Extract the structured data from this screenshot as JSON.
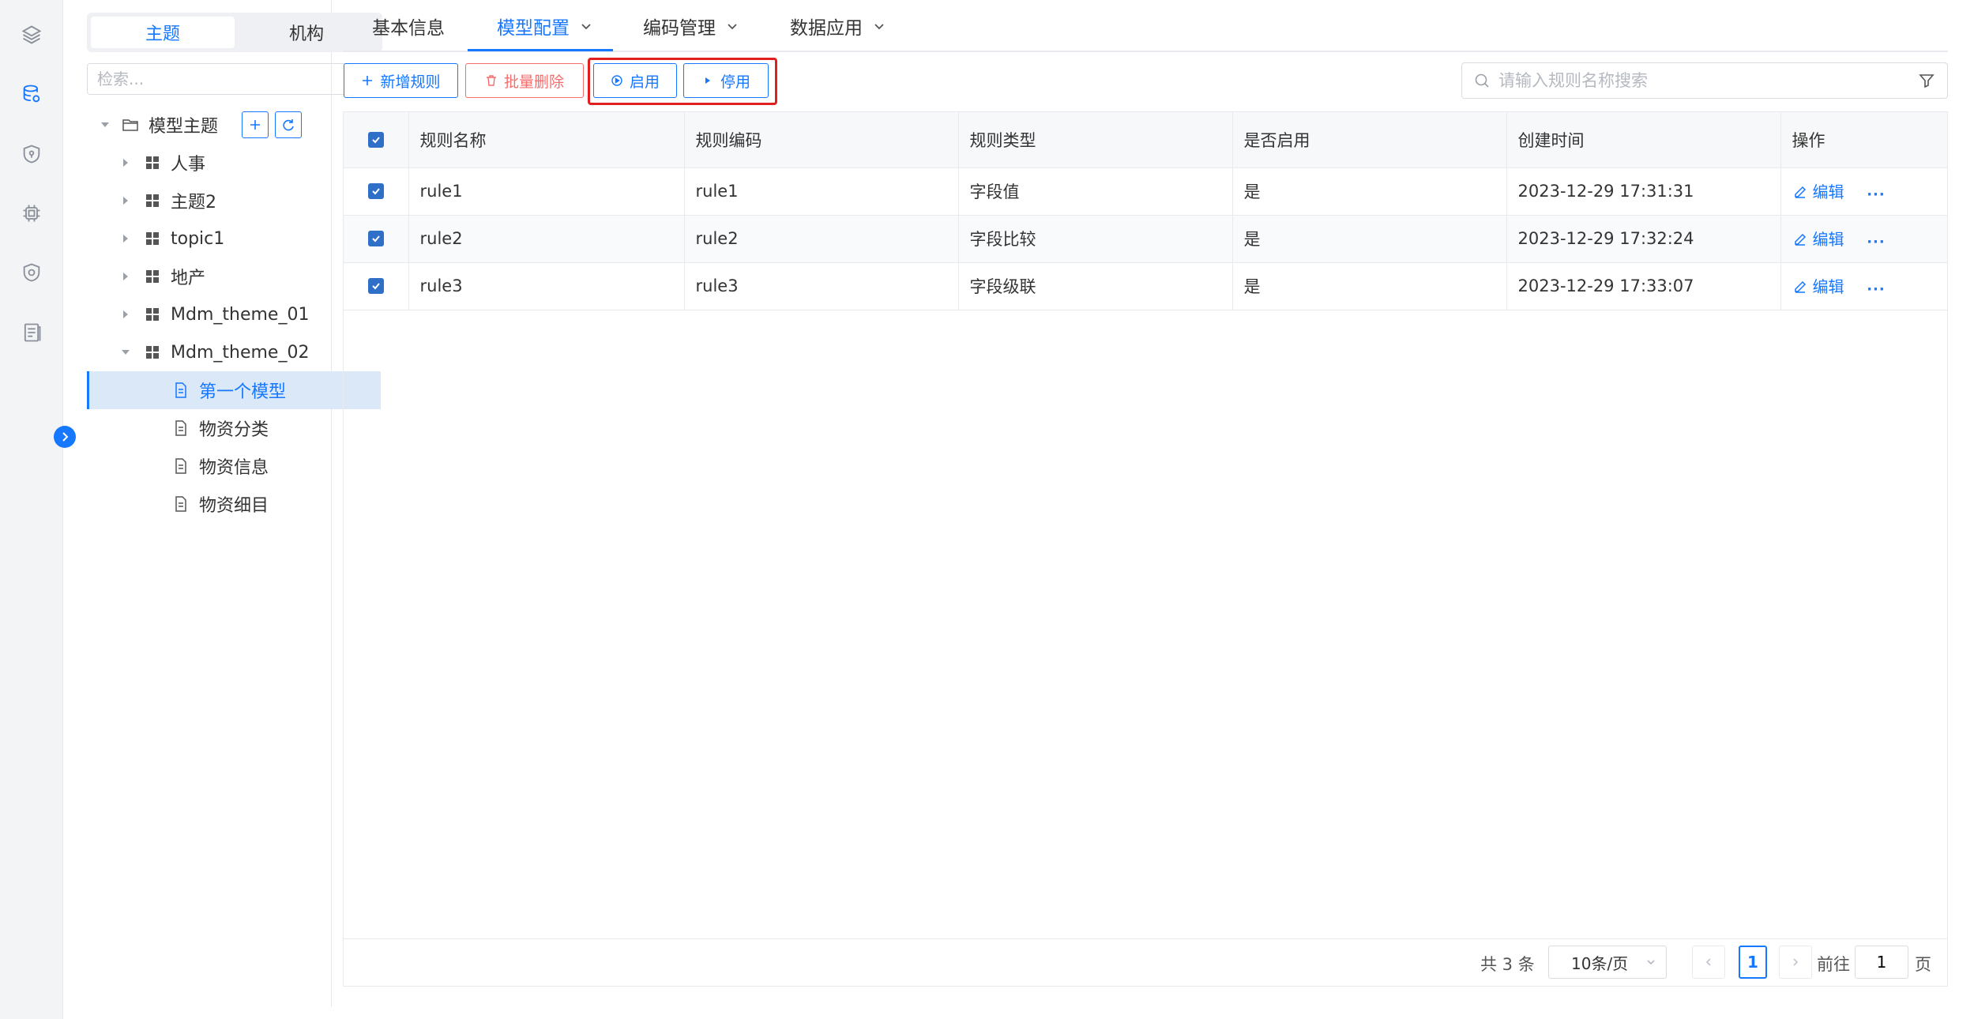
{
  "rail": {
    "icons": [
      "layers-icon",
      "database-icon",
      "shield-icon",
      "chip-icon",
      "security-icon",
      "document-list-icon"
    ],
    "active_index": 1
  },
  "tree_panel": {
    "segment": {
      "tab_topic": "主题",
      "tab_org": "机构"
    },
    "search_placeholder": "检索...",
    "root_label": "模型主题",
    "nodes": [
      {
        "label": "人事"
      },
      {
        "label": "主题2"
      },
      {
        "label": "topic1"
      },
      {
        "label": "地产"
      },
      {
        "label": "Mdm_theme_01"
      },
      {
        "label": "Mdm_theme_02"
      }
    ],
    "children": [
      {
        "label": "第一个模型"
      },
      {
        "label": "物资分类"
      },
      {
        "label": "物资信息"
      },
      {
        "label": "物资细目"
      }
    ]
  },
  "tabs": [
    {
      "label": "基本信息"
    },
    {
      "label": "模型配置"
    },
    {
      "label": "编码管理"
    },
    {
      "label": "数据应用"
    }
  ],
  "toolbar": {
    "add_label": "新增规则",
    "batch_delete_label": "批量删除",
    "enable_label": "启用",
    "disable_label": "停用",
    "search_placeholder": "请输入规则名称搜索"
  },
  "table": {
    "headers": [
      "规则名称",
      "规则编码",
      "规则类型",
      "是否启用",
      "创建时间",
      "操作"
    ],
    "rows": [
      {
        "name": "rule1",
        "code": "rule1",
        "type": "字段值",
        "enabled": "是",
        "created": "2023-12-29 17:31:31"
      },
      {
        "name": "rule2",
        "code": "rule2",
        "type": "字段比较",
        "enabled": "是",
        "created": "2023-12-29 17:32:24"
      },
      {
        "name": "rule3",
        "code": "rule3",
        "type": "字段级联",
        "enabled": "是",
        "created": "2023-12-29 17:33:07"
      }
    ],
    "edit_label": "编辑",
    "more_label": "···"
  },
  "pagination": {
    "total_text": "共 3 条",
    "page_size": "10条/页",
    "current_page": "1",
    "goto_label": "前往",
    "goto_value": "1",
    "page_suffix": "页"
  },
  "colors": {
    "accent": "#1677ff",
    "danger": "#f56c6c",
    "highlight": "#e02020"
  }
}
